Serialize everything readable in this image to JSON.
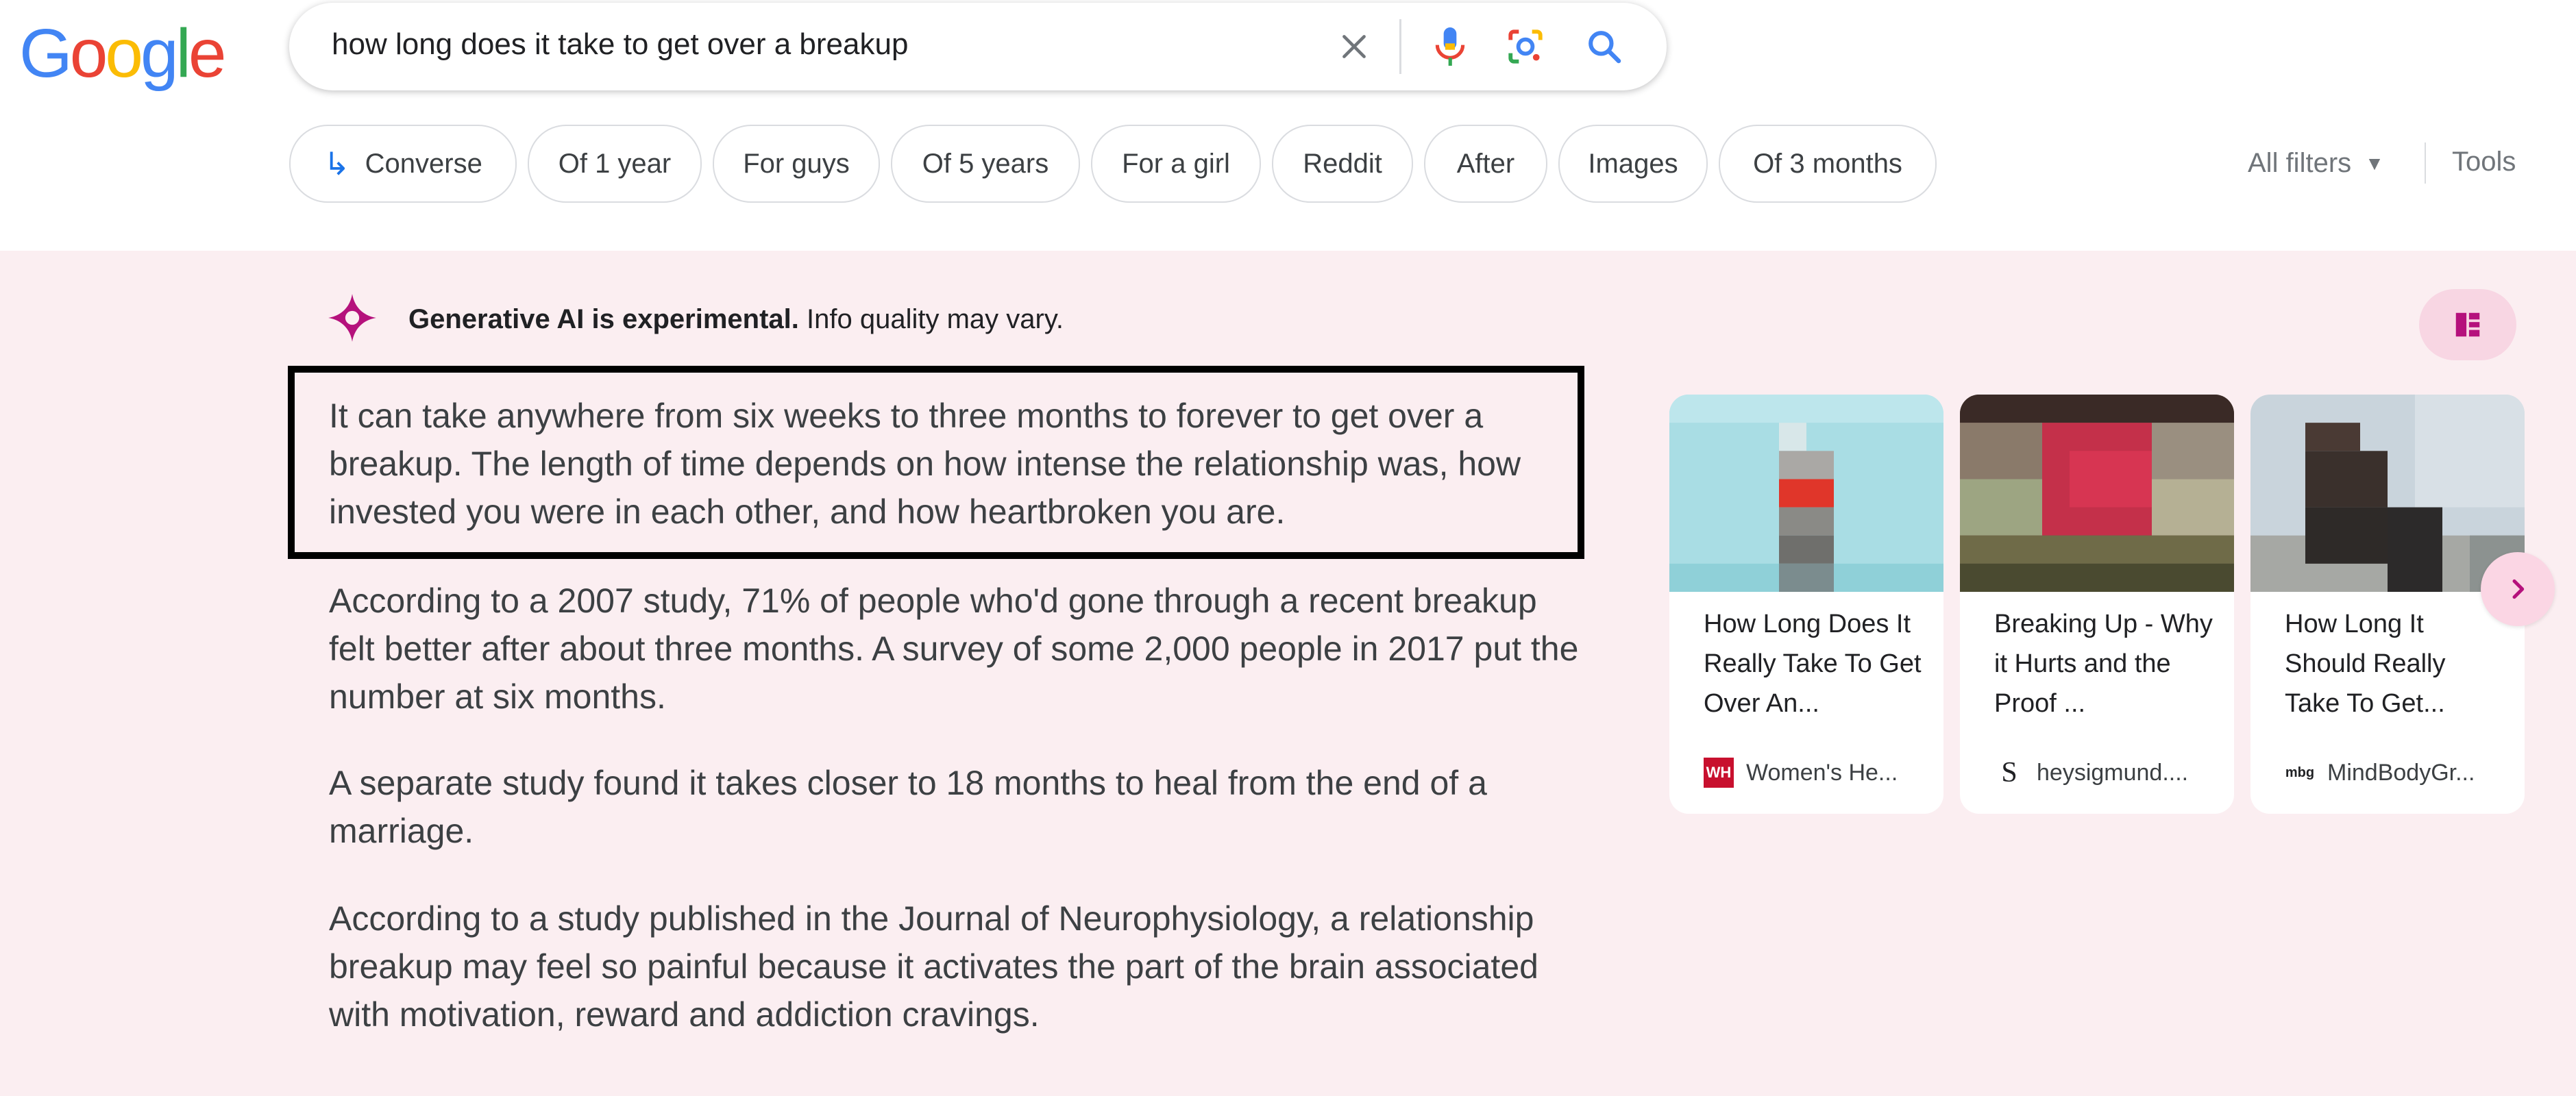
{
  "logo": {
    "text": "Google",
    "letters": [
      {
        "ch": "G",
        "color": "#4285F4"
      },
      {
        "ch": "o",
        "color": "#EA4335"
      },
      {
        "ch": "o",
        "color": "#FBBC05"
      },
      {
        "ch": "g",
        "color": "#4285F4"
      },
      {
        "ch": "l",
        "color": "#34A853"
      },
      {
        "ch": "e",
        "color": "#EA4335"
      }
    ]
  },
  "search": {
    "query": "how long does it take to get over a breakup",
    "icons": [
      "close-icon",
      "mic-icon",
      "lens-icon",
      "search-icon"
    ]
  },
  "chips": [
    {
      "label": "Converse",
      "icon": "converse-arrow-icon"
    },
    {
      "label": "Of 1 year"
    },
    {
      "label": "For guys"
    },
    {
      "label": "Of 5 years"
    },
    {
      "label": "For a girl"
    },
    {
      "label": "Reddit"
    },
    {
      "label": "After"
    },
    {
      "label": "Images"
    },
    {
      "label": "Of 3 months"
    }
  ],
  "filters": {
    "all_filters": "All filters",
    "tools": "Tools"
  },
  "ai_overview": {
    "notice_bold": "Generative AI is experimental.",
    "notice_rest": "Info quality may vary.",
    "accent_color": "#b5117c",
    "paragraphs": [
      "It can take anywhere from six weeks to three months to forever to get over a breakup. The length of time depends on how intense the relationship was, how invested you were in each other, and how heartbroken you are.",
      "According to a 2007 study, 71% of people who'd gone through a recent breakup felt better after about three months. A survey of some 2,000 people in 2017 put the number at six months.",
      "A separate study found it takes closer to 18 months to heal from the end of a marriage.",
      "According to a study published in the Journal of Neurophysiology, a relationship breakup may feel so painful because it activates the part of the brain associated with motivation, reward and addiction cravings."
    ],
    "cards": [
      {
        "title": "How Long Does It Really Take To Get Over An...",
        "source": "Women's He...",
        "favicon": "WH"
      },
      {
        "title": "Breaking Up - Why it Hurts and the Proof ...",
        "source": "heysigmund....",
        "favicon": "S"
      },
      {
        "title": "How Long It Should Really Take To Get...",
        "source": "MindBodyGr...",
        "favicon": "mbg"
      }
    ]
  }
}
